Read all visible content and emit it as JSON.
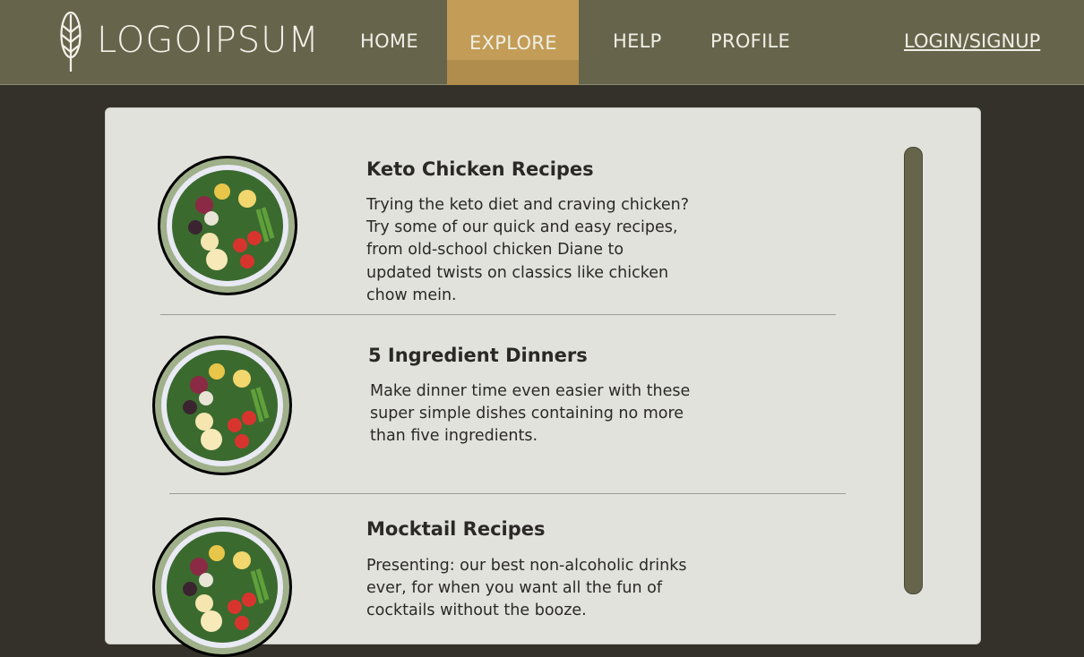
{
  "brand": {
    "name": "LOGOIPSUM"
  },
  "nav": {
    "links": [
      "HOME",
      "EXPLORE",
      "HELP",
      "PROFILE"
    ],
    "active": "EXPLORE",
    "login_label": "LOGIN/SIGNUP"
  },
  "items": [
    {
      "title": "Keto Chicken Recipes",
      "description": "Trying the keto diet and craving chicken? Try some of our quick and easy recipes, from old-school chicken Diane to updated twists on classics like chicken chow mein."
    },
    {
      "title": "5 Ingredient Dinners",
      "description": "Make dinner time even easier with these super simple dishes containing no more than five ingredients."
    },
    {
      "title": "Mocktail Recipes",
      "description": "Presenting: our best non-alcoholic drinks ever, for when you want all the fun of cocktails without the booze."
    }
  ],
  "colors": {
    "nav_bg": "#66654c",
    "accent": "#c39d57",
    "panel_bg": "#e2e2dd",
    "page_bg": "#33312a"
  }
}
